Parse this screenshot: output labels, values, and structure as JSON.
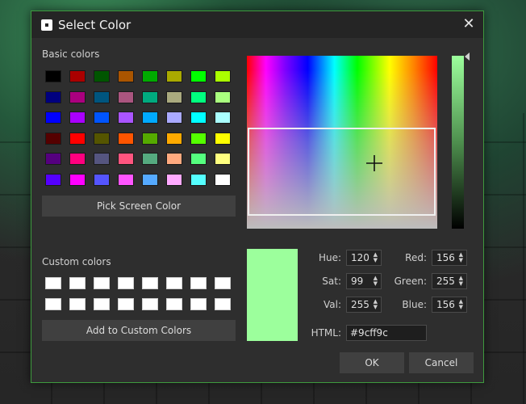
{
  "dialog": {
    "title": "Select Color",
    "close_icon": "close-icon",
    "app_icon": "roblox-logo-icon"
  },
  "basic_colors": {
    "label": "Basic colors",
    "swatches": [
      [
        "#000000",
        "#aa0000",
        "#005500",
        "#aa5500",
        "#00aa00",
        "#aaaa00",
        "#00ff00",
        "#aaff00"
      ],
      [
        "#00007f",
        "#aa007f",
        "#00557f",
        "#aa557f",
        "#00aa7f",
        "#aaaa7f",
        "#00ff7f",
        "#aaff7f"
      ],
      [
        "#0000ff",
        "#aa00ff",
        "#0055ff",
        "#aa55ff",
        "#00aaff",
        "#aaaaff",
        "#00ffff",
        "#aaffff"
      ],
      [
        "#550000",
        "#ff0000",
        "#555500",
        "#ff5500",
        "#55aa00",
        "#ffaa00",
        "#55ff00",
        "#ffff00"
      ],
      [
        "#55007f",
        "#ff007f",
        "#55557f",
        "#ff557f",
        "#55aa7f",
        "#ffaa7f",
        "#55ff7f",
        "#ffff7f"
      ],
      [
        "#5500ff",
        "#ff00ff",
        "#5555ff",
        "#ff55ff",
        "#55aaff",
        "#ffaaff",
        "#55ffff",
        "#ffffff"
      ]
    ]
  },
  "pick_screen_color": "Pick Screen Color",
  "custom_colors": {
    "label": "Custom colors",
    "rows": 2,
    "cols": 8
  },
  "add_to_custom": "Add to Custom Colors",
  "current_color": "#9cff9c",
  "fields": {
    "hue": {
      "label": "Hue:",
      "value": "120"
    },
    "sat": {
      "label": "Sat:",
      "value": "99"
    },
    "val": {
      "label": "Val:",
      "value": "255"
    },
    "red": {
      "label": "Red:",
      "value": "156"
    },
    "green": {
      "label": "Green:",
      "value": "255"
    },
    "blue": {
      "label": "Blue:",
      "value": "156"
    },
    "html": {
      "label": "HTML:",
      "value": "#9cff9c"
    }
  },
  "buttons": {
    "ok": "OK",
    "cancel": "Cancel"
  }
}
